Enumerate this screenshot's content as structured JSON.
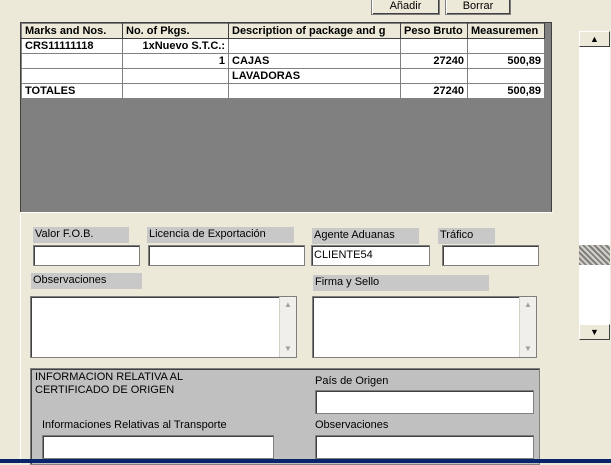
{
  "toolbar": {
    "add_label": "Añadir",
    "delete_label": "Borrar"
  },
  "grid": {
    "columns": [
      "Marks and Nos.",
      "No. of Pkgs.",
      "Description of package and g",
      "Peso Bruto",
      "Measuremen"
    ],
    "rows": [
      [
        "CRS11111118",
        "1xNuevo S.T.C.:",
        "",
        "",
        ""
      ],
      [
        "",
        "1",
        "CAJAS",
        "27240",
        "500,89"
      ],
      [
        "",
        "",
        "LAVADORAS",
        "",
        ""
      ],
      [
        "TOTALES",
        "",
        "",
        "27240",
        "500,89"
      ]
    ]
  },
  "form": {
    "valor_fob_label": "Valor F.O.B.",
    "valor_fob_value": "",
    "licencia_label": "Licencia de Exportación",
    "licencia_value": "",
    "agente_label": "Agente Aduanas",
    "agente_value": "CLIENTE54",
    "trafico_label": "Tráfico",
    "trafico_value": "",
    "observaciones_label": "Observaciones",
    "firma_label": "Firma y Sello"
  },
  "certificado": {
    "title_line1": "INFORMACION RELATIVA AL",
    "title_line2": "CERTIFICADO DE ORIGEN",
    "pais_label": "País de Origen",
    "pais_value": "",
    "transporte_label": "Informaciones Relativas al  Transporte",
    "observaciones_label": "Observaciones"
  },
  "icons": {
    "scroll_up": "scroll-up-arrow-icon",
    "scroll_down": "scroll-down-arrow-icon"
  }
}
